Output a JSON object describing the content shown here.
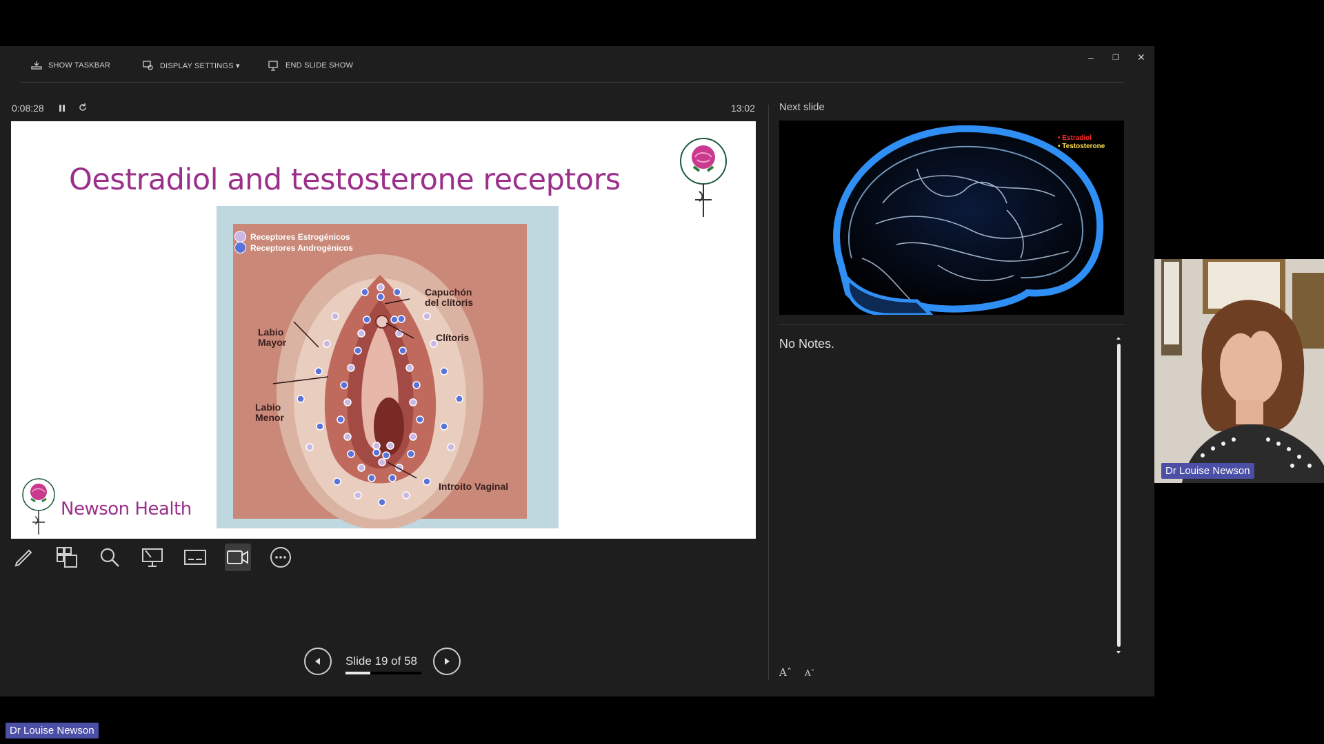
{
  "toolbar": {
    "show_taskbar": "SHOW TASKBAR",
    "display_settings": "DISPLAY SETTINGS ▾",
    "end_slide_show": "END SLIDE SHOW"
  },
  "window_controls": {
    "minimize": "–",
    "restore": "❐",
    "close": "✕"
  },
  "timer": {
    "elapsed": "0:08:28",
    "clock": "13:02"
  },
  "current_slide": {
    "title": "Oestradiol and testosterone receptors",
    "brand": "Newson Health",
    "diagram": {
      "legend": [
        "Receptores Estrogénicos",
        "Receptores Androgénicos"
      ],
      "legend_colors": [
        "#c9b7e6",
        "#5a73d9"
      ],
      "labels": {
        "capuchon": "Capuchón del clítoris",
        "clitoris": "Clítoris",
        "labio_mayor": "Labio Mayor",
        "labio_menor": "Labio Menor",
        "introito": "Introito Vaginal"
      }
    }
  },
  "tools": [
    "pen-icon",
    "slides-grid-icon",
    "zoom-icon",
    "pointer-screen-icon",
    "subtitles-icon",
    "camera-icon",
    "more-icon"
  ],
  "navigation": {
    "counter": "Slide 19 of 58",
    "current": 19,
    "total": 58
  },
  "next_slide": {
    "label": "Next slide",
    "legend": [
      "• Estradiol",
      "• Testosterone"
    ],
    "legend_colors": [
      "#ff2b2b",
      "#ffe14d"
    ]
  },
  "notes": {
    "text": "No Notes."
  },
  "font_controls": {
    "increase": "Aˆ",
    "decrease": "Aˇ"
  },
  "participants": {
    "speaker": "Dr Louise Newson"
  },
  "colors": {
    "brand": "#9b2f8a",
    "name_tag": "#4b4fa6",
    "background": "#1e1e1e"
  }
}
